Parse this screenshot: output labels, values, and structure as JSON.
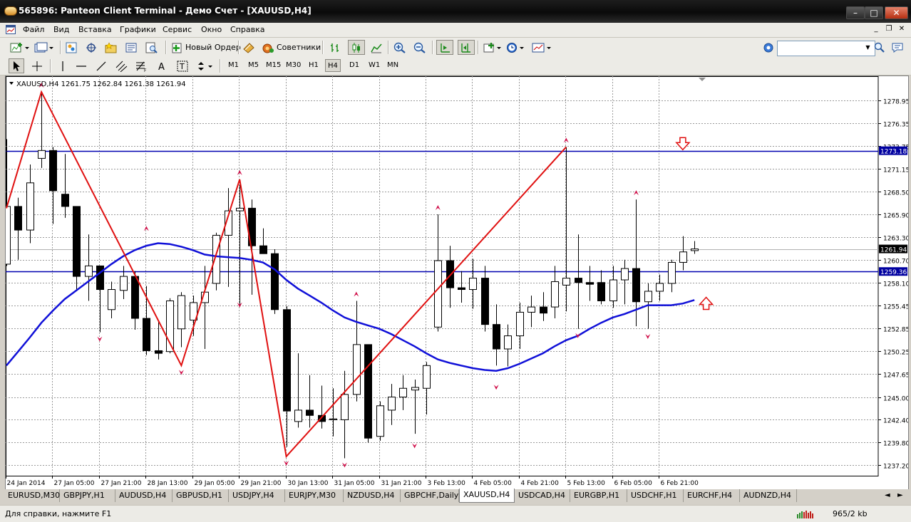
{
  "window": {
    "title": "565896: Panteon Client Terminal - Демо Счет - [XAUUSD,H4]"
  },
  "menu": [
    "Файл",
    "Вид",
    "Вставка",
    "Графики",
    "Сервис",
    "Окно",
    "Справка"
  ],
  "toolbar1": {
    "new_order_label": "Новый Ордер",
    "experts_label": "Советники",
    "search_placeholder": ""
  },
  "timeframes": [
    "M1",
    "M5",
    "M15",
    "M30",
    "H1",
    "H4",
    "D1",
    "W1",
    "MN"
  ],
  "active_timeframe": "H4",
  "chart": {
    "header": "XAUUSD,H4  1261.75 1262.84 1261.38 1261.94",
    "current_price_label": "1261.94",
    "hline_upper_label": "1273.18",
    "hline_lower_label": "1259.36",
    "colors": {
      "bull_body": "#ffffff",
      "bear_body": "#000000",
      "ma": "#1010d8",
      "zigzag": "#e01010",
      "hline": "#0000b0",
      "fractal": "#d0104a",
      "arrow": "#e01010"
    }
  },
  "chart_data": {
    "type": "candlestick",
    "symbol": "XAUUSD",
    "timeframe": "H4",
    "ylim": [
      1236,
      1281.7
    ],
    "price_ticks": [
      "1278.95",
      "1276.35",
      "1273.75",
      "1271.15",
      "1268.50",
      "1265.90",
      "1263.30",
      "1260.70",
      "1258.10",
      "1255.45",
      "1252.85",
      "1250.25",
      "1247.65",
      "1245.00",
      "1242.40",
      "1239.80",
      "1237.20"
    ],
    "time_labels": [
      "24 Jan 2014",
      "27 Jan 05:00",
      "27 Jan 21:00",
      "28 Jan 13:00",
      "29 Jan 05:00",
      "29 Jan 21:00",
      "30 Jan 13:00",
      "31 Jan 05:00",
      "31 Jan 21:00",
      "3 Feb 13:00",
      "4 Feb 05:00",
      "4 Feb 21:00",
      "5 Feb 13:00",
      "6 Feb 05:00",
      "6 Feb 21:00"
    ],
    "candles": [
      [
        1260.2,
        1274.5,
        1260.0,
        1266.8
      ],
      [
        1266.8,
        1267.8,
        1260.7,
        1264.1
      ],
      [
        1264.1,
        1271.6,
        1262.6,
        1269.5
      ],
      [
        1272.3,
        1279.9,
        1271.2,
        1273.2
      ],
      [
        1273.2,
        1273.6,
        1264.8,
        1268.6
      ],
      [
        1268.2,
        1272.8,
        1265.5,
        1266.8
      ],
      [
        1266.8,
        1266.8,
        1257.1,
        1258.8
      ],
      [
        1258.8,
        1263.6,
        1256.0,
        1260.0
      ],
      [
        1260.0,
        1260.0,
        1252.4,
        1257.3
      ],
      [
        1255.0,
        1258.2,
        1254.0,
        1257.3
      ],
      [
        1257.2,
        1260.0,
        1256.2,
        1258.8
      ],
      [
        1258.8,
        1259.4,
        1252.7,
        1254.0
      ],
      [
        1254.0,
        1257.7,
        1249.8,
        1250.3
      ],
      [
        1250.3,
        1253.8,
        1249.3,
        1250.0
      ],
      [
        1250.2,
        1256.3,
        1250.0,
        1256.0
      ],
      [
        1252.8,
        1257.0,
        1250.7,
        1256.6
      ],
      [
        1253.8,
        1256.6,
        1252.0,
        1255.8
      ],
      [
        1255.8,
        1260.0,
        1250.5,
        1257.0
      ],
      [
        1258.0,
        1263.8,
        1257.2,
        1263.5
      ],
      [
        1263.5,
        1268.9,
        1257.6,
        1266.3
      ],
      [
        1266.3,
        1269.3,
        1255.4,
        1266.6
      ],
      [
        1266.6,
        1267.6,
        1256.7,
        1262.3
      ],
      [
        1262.3,
        1264.3,
        1261.6,
        1261.4
      ],
      [
        1261.4,
        1261.9,
        1254.5,
        1255.0
      ],
      [
        1255.0,
        1255.4,
        1239.3,
        1243.4
      ],
      [
        1242.2,
        1250.0,
        1241.5,
        1243.5
      ],
      [
        1243.5,
        1247.5,
        1241.5,
        1242.9
      ],
      [
        1242.9,
        1246.3,
        1241.4,
        1242.2
      ],
      [
        1242.4,
        1246.0,
        1240.5,
        1242.5
      ],
      [
        1242.4,
        1248.0,
        1238.0,
        1245.3
      ],
      [
        1245.3,
        1256.0,
        1244.5,
        1251.0
      ],
      [
        1251.0,
        1251.0,
        1239.8,
        1240.3
      ],
      [
        1240.5,
        1244.5,
        1240.0,
        1244.0
      ],
      [
        1243.5,
        1246.5,
        1241.8,
        1245.0
      ],
      [
        1245.0,
        1247.5,
        1243.5,
        1246.0
      ],
      [
        1245.8,
        1247.0,
        1240.8,
        1246.1
      ],
      [
        1246.0,
        1249.0,
        1243.0,
        1248.6
      ],
      [
        1253.0,
        1265.9,
        1252.5,
        1260.6
      ],
      [
        1260.6,
        1262.3,
        1255.2,
        1257.5
      ],
      [
        1257.5,
        1259.4,
        1255.8,
        1257.3
      ],
      [
        1257.3,
        1260.8,
        1255.1,
        1258.6
      ],
      [
        1258.6,
        1260.0,
        1252.5,
        1253.3
      ],
      [
        1253.3,
        1255.6,
        1248.6,
        1250.5
      ],
      [
        1250.5,
        1253.3,
        1248.5,
        1252.0
      ],
      [
        1252.0,
        1255.8,
        1250.5,
        1254.7
      ],
      [
        1254.7,
        1256.6,
        1253.0,
        1255.3
      ],
      [
        1255.3,
        1257.0,
        1253.7,
        1254.6
      ],
      [
        1255.3,
        1260.0,
        1254.0,
        1258.2
      ],
      [
        1257.8,
        1273.6,
        1254.8,
        1258.6
      ],
      [
        1258.6,
        1263.6,
        1252.8,
        1258.1
      ],
      [
        1258.1,
        1260.0,
        1256.0,
        1257.9
      ],
      [
        1258.1,
        1259.5,
        1255.6,
        1256.0
      ],
      [
        1256.0,
        1260.0,
        1255.2,
        1258.4
      ],
      [
        1258.4,
        1260.7,
        1255.6,
        1259.7
      ],
      [
        1259.7,
        1267.6,
        1253.1,
        1255.9
      ],
      [
        1255.9,
        1258.0,
        1252.8,
        1257.1
      ],
      [
        1257.1,
        1259.0,
        1256.0,
        1258.0
      ],
      [
        1258.0,
        1260.7,
        1257.0,
        1260.4
      ],
      [
        1260.4,
        1263.4,
        1259.5,
        1261.6
      ],
      [
        1261.75,
        1262.84,
        1261.38,
        1261.94
      ]
    ],
    "moving_average": [
      1248.6,
      1250.2,
      1251.8,
      1253.5,
      1254.9,
      1256.2,
      1257.2,
      1258.2,
      1259.2,
      1260.2,
      1261.1,
      1261.8,
      1262.3,
      1262.6,
      1262.5,
      1262.2,
      1261.8,
      1261.3,
      1261.1,
      1261.0,
      1260.9,
      1260.7,
      1260.4,
      1259.6,
      1258.4,
      1257.4,
      1256.6,
      1255.8,
      1254.9,
      1254.1,
      1253.6,
      1253.2,
      1252.8,
      1252.2,
      1251.5,
      1250.8,
      1250.0,
      1249.3,
      1248.9,
      1248.6,
      1248.3,
      1248.1,
      1248.0,
      1248.3,
      1248.8,
      1249.4,
      1250.0,
      1250.8,
      1251.5,
      1252.0,
      1252.8,
      1253.5,
      1254.1,
      1254.5,
      1255.0,
      1255.5,
      1255.5,
      1255.5,
      1255.7,
      1256.1
    ],
    "zigzag": [
      [
        0,
        1266.6
      ],
      [
        3,
        1279.9
      ],
      [
        15,
        1248.6
      ],
      [
        20,
        1269.9
      ],
      [
        24,
        1238.2
      ],
      [
        48,
        1273.6
      ]
    ],
    "fractals_up": [
      [
        3,
        1279.9
      ],
      [
        12,
        1263.5
      ],
      [
        20,
        1269.9
      ],
      [
        30,
        1256.0
      ],
      [
        37,
        1265.9
      ],
      [
        48,
        1273.6
      ],
      [
        54,
        1267.6
      ]
    ],
    "fractals_down": [
      [
        8,
        1252.4
      ],
      [
        15,
        1248.6
      ],
      [
        20,
        1256.3
      ],
      [
        24,
        1238.2
      ],
      [
        29,
        1238.0
      ],
      [
        35,
        1240.2
      ],
      [
        42,
        1246.9
      ],
      [
        49,
        1252.8
      ],
      [
        55,
        1252.7
      ]
    ],
    "hlines": [
      1273.18,
      1259.36
    ],
    "hline_colors": [
      "#0000b0",
      "#0000b0"
    ],
    "arrows": [
      {
        "dir": "down",
        "bar": 58,
        "price": 1273.7
      },
      {
        "dir": "up",
        "bar": 60,
        "price": 1256.0
      }
    ]
  },
  "tabs": [
    "EURUSD,M30",
    "GBPJPY,H1",
    "AUDUSD,H4",
    "GBPUSD,H1",
    "USDJPY,H4",
    "EURJPY,M30",
    "NZDUSD,H4",
    "GBPCHF,Daily",
    "XAUUSD,H4",
    "USDCAD,H4",
    "EURGBP,H1",
    "USDCHF,H1",
    "EURCHF,H4",
    "AUDNZD,H4"
  ],
  "active_tab": "XAUUSD,H4",
  "status": {
    "help": "Для справки, нажмите F1",
    "traffic": "965/2 kb"
  }
}
